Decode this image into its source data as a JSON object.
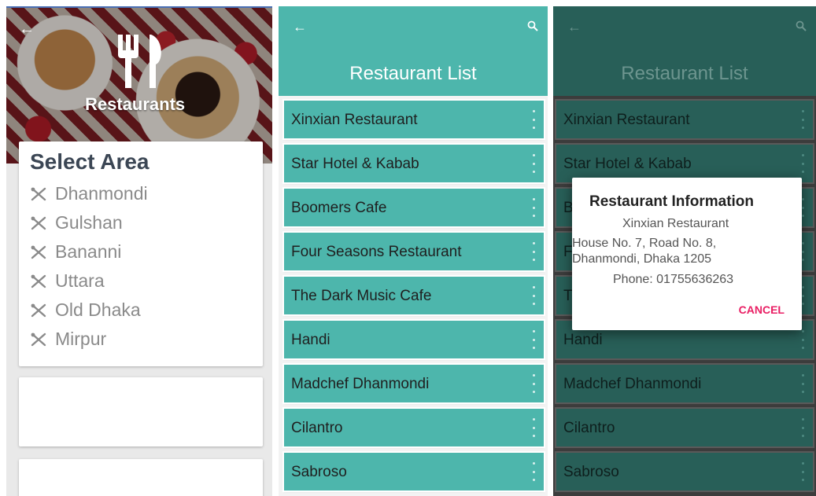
{
  "screen1": {
    "hero_title": "Restaurants",
    "back_icon": "arrow-left-icon",
    "logo_icon": "fork-knife-icon",
    "section_title": "Select Area",
    "areas": [
      {
        "label": "Dhanmondi",
        "icon": "utensils-cross-icon"
      },
      {
        "label": "Gulshan",
        "icon": "utensils-cross-icon"
      },
      {
        "label": "Bananni",
        "icon": "utensils-cross-icon"
      },
      {
        "label": "Uttara",
        "icon": "utensils-cross-icon"
      },
      {
        "label": "Old Dhaka",
        "icon": "utensils-cross-icon"
      },
      {
        "label": "Mirpur",
        "icon": "utensils-cross-icon"
      }
    ]
  },
  "screen2": {
    "title": "Restaurant List",
    "back_icon": "arrow-left-icon",
    "search_icon": "search-icon",
    "restaurants": [
      "Xinxian Restaurant",
      "Star Hotel & Kabab",
      "Boomers Cafe",
      "Four Seasons Restaurant",
      "The Dark Music Cafe",
      "Handi",
      "Madchef Dhanmondi",
      "Cilantro",
      "Sabroso"
    ]
  },
  "screen3": {
    "title": "Restaurant List",
    "dialog": {
      "title": "Restaurant Information",
      "name": "Xinxian Restaurant",
      "address_line1": "House No. 7, Road No. 8,",
      "address_line2": "Dhanmondi, Dhaka 1205",
      "phone": "Phone: 01755636263",
      "cancel_label": "CANCEL"
    },
    "visible_row_prefixes": [
      "B",
      "F",
      "T"
    ]
  },
  "colors": {
    "teal": "#4db6ac",
    "teal_dim": "#285f58",
    "area_title": "#3b4654",
    "accent_pink": "#e91e63"
  }
}
